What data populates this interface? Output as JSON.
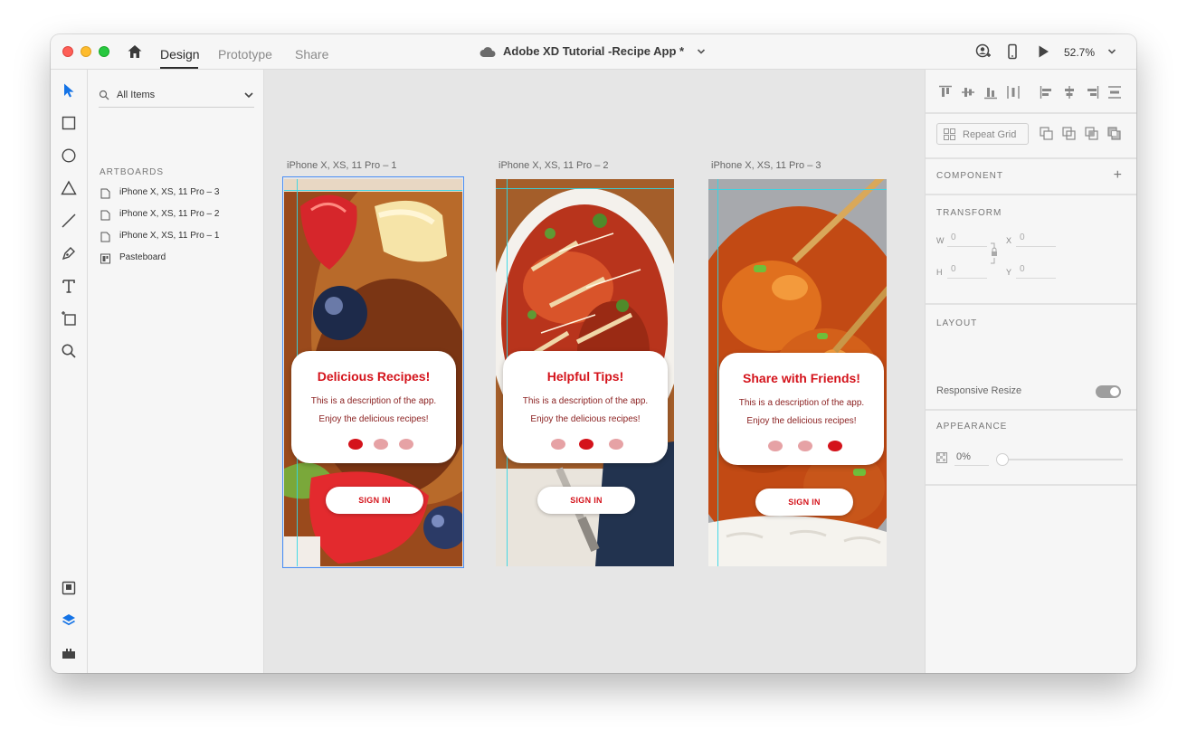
{
  "titlebar": {
    "tabs": [
      "Design",
      "Prototype",
      "Share"
    ],
    "active_tab": "Design",
    "document_title": "Adobe XD Tutorial -Recipe App *",
    "zoom": "52.7%"
  },
  "layers": {
    "filter": "All Items",
    "section": "ARTBOARDS",
    "items": [
      {
        "label": "iPhone X, XS, 11 Pro – 3",
        "icon": "artboard-icon"
      },
      {
        "label": "iPhone X, XS, 11 Pro – 2",
        "icon": "artboard-icon"
      },
      {
        "label": "iPhone X, XS, 11 Pro – 1",
        "icon": "artboard-icon"
      },
      {
        "label": "Pasteboard",
        "icon": "pasteboard-icon"
      }
    ]
  },
  "artboards": [
    {
      "label": "iPhone X, XS, 11 Pro – 1",
      "title": "Delicious Recipes!",
      "desc1": "This is a description of the app.",
      "desc2": "Enjoy the delicious recipes!",
      "active_dot": 1,
      "button": "SIGN IN",
      "selected": true
    },
    {
      "label": "iPhone X, XS, 11 Pro – 2",
      "title": "Helpful Tips!",
      "desc1": "This is a description of the app.",
      "desc2": "Enjoy the delicious recipes!",
      "active_dot": 2,
      "button": "SIGN IN",
      "selected": false
    },
    {
      "label": "iPhone X, XS, 11 Pro – 3",
      "title": "Share with Friends!",
      "desc1": "This is a description of the app.",
      "desc2": "Enjoy the delicious recipes!",
      "active_dot": 3,
      "button": "SIGN IN",
      "selected": false
    }
  ],
  "properties": {
    "repeat_grid": "Repeat Grid",
    "component": "COMPONENT",
    "transform": "TRANSFORM",
    "w_key": "W",
    "w_val": "0",
    "h_key": "H",
    "h_val": "0",
    "x_key": "X",
    "x_val": "0",
    "y_key": "Y",
    "y_val": "0",
    "layout": "LAYOUT",
    "responsive_resize": "Responsive Resize",
    "responsive_on": false,
    "appearance": "APPEARANCE",
    "opacity": "0%"
  },
  "colors": {
    "brand_red": "#d4131b",
    "dot_inactive": "#e6a2a5",
    "selection": "#4b8ef5",
    "guide": "#33d6e6",
    "tool_active": "#1473e6"
  }
}
